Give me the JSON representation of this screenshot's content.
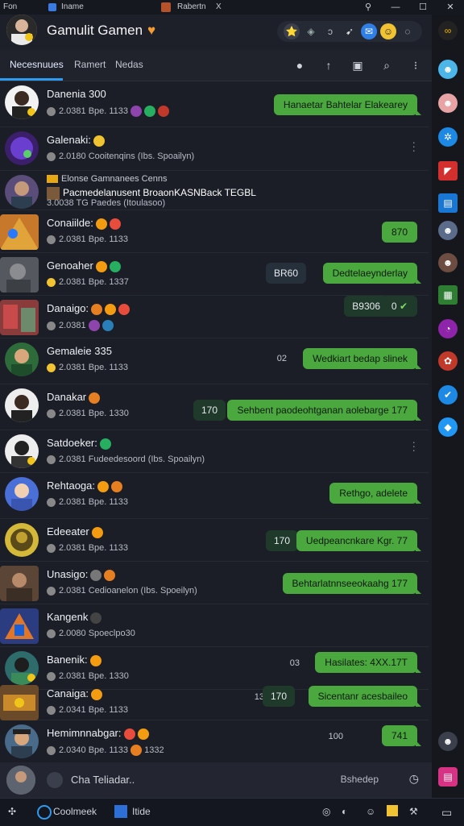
{
  "titlebar": {
    "left_label": "Fon",
    "app_label": "Iname",
    "tab_label": "Rabertn",
    "tab_close": "X"
  },
  "header": {
    "title": "Gamulit Gamen",
    "heart": "♥"
  },
  "tabs": {
    "t1": "Necesnuues",
    "t2": "Ramert",
    "t3": "Nedas"
  },
  "chats": [
    {
      "name": "Danenia   300",
      "meta": "2.0381 Bpe. 1133",
      "bubble": "Hanaetar Bahtelar Elakearey"
    },
    {
      "name": "Galenaki:",
      "meta": "2.0180 Cooitenqins (Ibs. Spoailyn)"
    },
    {
      "name": "Elonse Gamnanees Cenns",
      "name2": "Pacmedelanusent BroaonKASNBack TEGBL",
      "meta": "3.0038 TG Paedes (Itoulasoo)"
    },
    {
      "name": "Conaiilde:",
      "meta": "2.0381 Bpe. 1133",
      "bubble": "870"
    },
    {
      "name": "Genoaher",
      "meta": "2.0381 Bpe. 1337",
      "chip": "BR60",
      "bubble": "Dedtelaeynderlay"
    },
    {
      "name": "Danaigo:",
      "meta": "2.0381",
      "chip": "B9306",
      "bubble": "0"
    },
    {
      "name": "Gemaleie  335",
      "meta": "2.0381 Bpe. 1133",
      "num": "02",
      "bubble": "Wedkiart bedap slinek"
    },
    {
      "name": "Danakar",
      "meta": "2.0381 Bpe. 1330",
      "chip": "170",
      "bubble": "Sehbent paodeohtganan aolebarge 177"
    },
    {
      "name": "Satdoeker:",
      "meta": "2.0381 Fudeedesoord (Ibs. Spoailyn)"
    },
    {
      "name": "Rehtaoga:",
      "meta": "2.0381 Bpe. 1133",
      "bubble": "Rethgo, adelete"
    },
    {
      "name": "Edeeater",
      "meta": "2.0381 Bpe. 1133",
      "chip": "170",
      "bubble": "Uedpeancnkare Kgr. 77"
    },
    {
      "name": "Unasigo:",
      "meta": "2.0381 Cedioanelon (Ibs. Spoeilyn)",
      "bubble": "Behtarlatnnseeokaahg 177"
    },
    {
      "name": "Kangenk",
      "meta": "2.0080 Spoeclpo30"
    },
    {
      "name": "Banenik:",
      "meta": "2.0381 Bpe. 1330",
      "num": "03",
      "bubble": "Hasilates: 4XX.17T"
    },
    {
      "name": "Canaiga:",
      "meta": "2.0341 Bpe. 1133",
      "num": "13",
      "chip": "170",
      "bubble": "Sicentanr acesbaileo"
    },
    {
      "name": "Hemimnnabgar:",
      "meta": "2.0340 Bpe. 1133",
      "meta2": "1332",
      "num": "100",
      "bubble": "741"
    }
  ],
  "composer": {
    "placeholder": "Cha Teliadar..",
    "selector": "Bshedep"
  },
  "taskbar": {
    "item1": "Coolmeek",
    "item2": "Itide"
  },
  "colors": {
    "accent": "#2d9cf0",
    "bubble_green": "#4aa83f",
    "background": "#1b1e26"
  }
}
